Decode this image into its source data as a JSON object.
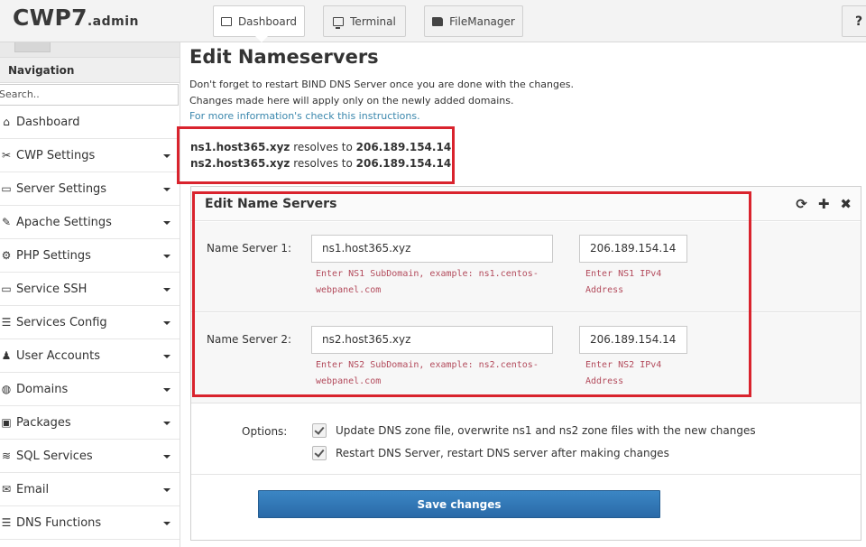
{
  "app": {
    "logo": "CWP7",
    "logo_sub": ".admin"
  },
  "top_nav": [
    {
      "label": "Dashboard",
      "icon": "monitor-icon"
    },
    {
      "label": "Terminal",
      "icon": "terminal-icon"
    },
    {
      "label": "FileManager",
      "icon": "folder-icon"
    }
  ],
  "help_label": "?",
  "sidebar": {
    "heading": "Navigation",
    "search_text": "Search..",
    "items": [
      {
        "label": "Dashboard",
        "icon": "home-icon",
        "glyph": "⌂"
      },
      {
        "label": "CWP Settings",
        "icon": "tools-icon",
        "glyph": "✂"
      },
      {
        "label": "Server Settings",
        "icon": "monitor-icon",
        "glyph": "▭"
      },
      {
        "label": "Apache Settings",
        "icon": "feather-icon",
        "glyph": "✎"
      },
      {
        "label": "PHP Settings",
        "icon": "gear-icon",
        "glyph": "⚙"
      },
      {
        "label": "Service SSH",
        "icon": "monitor-icon",
        "glyph": "▭"
      },
      {
        "label": "Services Config",
        "icon": "list-icon",
        "glyph": "☰"
      },
      {
        "label": "User Accounts",
        "icon": "user-icon",
        "glyph": "♟"
      },
      {
        "label": "Domains",
        "icon": "globe-icon",
        "glyph": "◍"
      },
      {
        "label": "Packages",
        "icon": "cubes-icon",
        "glyph": "▣"
      },
      {
        "label": "SQL Services",
        "icon": "database-icon",
        "glyph": "≋"
      },
      {
        "label": "Email",
        "icon": "envelope-icon",
        "glyph": "✉"
      },
      {
        "label": "DNS Functions",
        "icon": "list-icon",
        "glyph": "☰"
      }
    ]
  },
  "main": {
    "title": "Edit Nameservers",
    "intro_line1": "Don't forget to restart BIND DNS Server once you are done with the changes.",
    "intro_line2": "Changes made here will apply only on the newly added domains.",
    "intro_link": "For more information's check this instructions.",
    "resolves": [
      {
        "host": "ns1.host365.xyz",
        "text": " resolves to ",
        "ip": "206.189.154.14"
      },
      {
        "host": "ns2.host365.xyz",
        "text": " resolves to ",
        "ip": "206.189.154.14"
      }
    ],
    "widget": {
      "title": "Edit Name Servers",
      "tools": [
        "⟳",
        "✚",
        "✖"
      ],
      "ns1": {
        "label": "Name Server 1:",
        "value": "ns1.host365.xyz",
        "help1": "Enter NS1 SubDomain, example: ns1.centos-",
        "help2": "webpanel.com",
        "ip": "206.189.154.14",
        "ip_help1": "Enter NS1 IPv4",
        "ip_help2": "Address"
      },
      "ns2": {
        "label": "Name Server 2:",
        "value": "ns2.host365.xyz",
        "help1": "Enter NS2 SubDomain, example: ns2.centos-",
        "help2": "webpanel.com",
        "ip": "206.189.154.14",
        "ip_help1": "Enter NS2 IPv4",
        "ip_help2": "Address"
      },
      "options_label": "Options:",
      "options": [
        {
          "label": "Update DNS zone file, overwrite ns1 and ns2 zone files with the new changes",
          "checked": true
        },
        {
          "label": "Restart DNS Server, restart DNS server after making changes",
          "checked": true
        }
      ],
      "save_label": "Save changes"
    }
  },
  "colors": {
    "highlight": "#d9232d",
    "button": "#2f75b5",
    "help_text": "#b34b5c",
    "link": "#3a87ad"
  }
}
